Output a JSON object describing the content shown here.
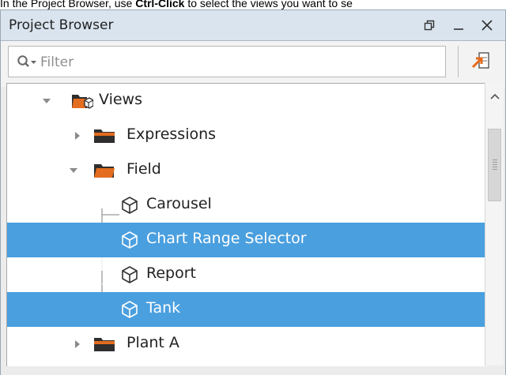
{
  "caption": {
    "prefix": "In the Project Browser, use ",
    "bold": "Ctrl-Click",
    "suffix": " to select the views you want to se"
  },
  "panel": {
    "title": "Project Browser",
    "buttons": {
      "restore": "restore-icon",
      "minimize": "minimize-icon",
      "close": "close-icon"
    }
  },
  "filter": {
    "placeholder": "Filter",
    "value": ""
  },
  "tree": {
    "selection_color": "#4a9fdf",
    "items": [
      {
        "label": "Views",
        "icon": "views-folder-icon",
        "expanded": true
      },
      {
        "label": "Expressions",
        "icon": "folder-icon",
        "expanded": false
      },
      {
        "label": "Field",
        "icon": "folder-open-icon",
        "expanded": true
      },
      {
        "label": "Carousel",
        "icon": "view-cube-icon",
        "selected": false
      },
      {
        "label": "Chart Range Selector",
        "icon": "view-cube-icon",
        "selected": true
      },
      {
        "label": "Report",
        "icon": "view-cube-icon",
        "selected": false
      },
      {
        "label": "Tank",
        "icon": "view-cube-icon",
        "selected": true
      },
      {
        "label": "Plant A",
        "icon": "folder-icon",
        "expanded": false
      }
    ]
  }
}
